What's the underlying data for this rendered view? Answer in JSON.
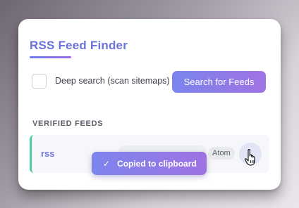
{
  "app": {
    "title": "RSS Feed Finder"
  },
  "options": {
    "deep_search_label": "Deep search (scan sitemaps)",
    "deep_search_checked": false
  },
  "actions": {
    "search_label": "Search for Feeds"
  },
  "results": {
    "section_title": "VERIFIED FEEDS",
    "feeds": [
      {
        "name": "rss",
        "type": "Atom",
        "status_color": "#4fcf9c"
      }
    ]
  },
  "toast": {
    "icon": "check-icon",
    "message": "Copied to clipboard"
  },
  "colors": {
    "accent": "#6a72dd",
    "gradient_start": "#7a84ee",
    "gradient_end": "#a173e3",
    "verified": "#4fcf9c"
  }
}
